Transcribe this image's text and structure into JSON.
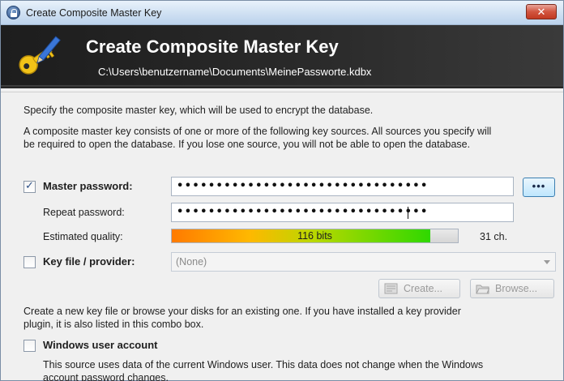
{
  "window": {
    "title": "Create Composite Master Key",
    "close_label": "✕"
  },
  "banner": {
    "title": "Create Composite Master Key",
    "path": "C:\\Users\\benutzername\\Documents\\MeinePassworte.kdbx"
  },
  "intro": {
    "line1": "Specify the composite master key, which will be used to encrypt the database.",
    "line2a": "A composite master key consists of one or more of the following key sources. All sources you specify will",
    "line2b": "be required to open the database.  If you lose one source, you will not be able to open the database."
  },
  "master_password": {
    "checked": true,
    "label": "Master password:",
    "value": "••••••••••••••••••••••••••••••••",
    "reveal_label": "•••"
  },
  "repeat_password": {
    "label": "Repeat password:",
    "value": "••••••••••••••••••••••••••••••••"
  },
  "quality": {
    "label": "Estimated quality:",
    "bits_text": "116 bits",
    "fill_fraction": 0.905,
    "chars_text": "31 ch."
  },
  "key_file": {
    "checked": false,
    "label": "Key file / provider:",
    "selected": "(None)",
    "create_label": "Create...",
    "browse_label": "Browse...",
    "hint_a": "Create a new key file or browse your disks for an existing one. If you have installed a key provider",
    "hint_b": "plugin, it is also listed in this combo box."
  },
  "windows_account": {
    "checked": false,
    "label": "Windows user account",
    "hint_a": "This source uses data of the current Windows user. This data does not change when the Windows",
    "hint_b": "account password changes."
  },
  "colors": {
    "banner_bg": "#1d1d1d",
    "quality_low": "#ff7a00",
    "quality_high": "#2fd800",
    "close_button": "#c23a22"
  },
  "icons": [
    "lock-icon",
    "key-pen-icon",
    "close-icon",
    "checkbox-icon",
    "dropdown-arrow-icon",
    "create-file-icon",
    "browse-folder-icon"
  ]
}
